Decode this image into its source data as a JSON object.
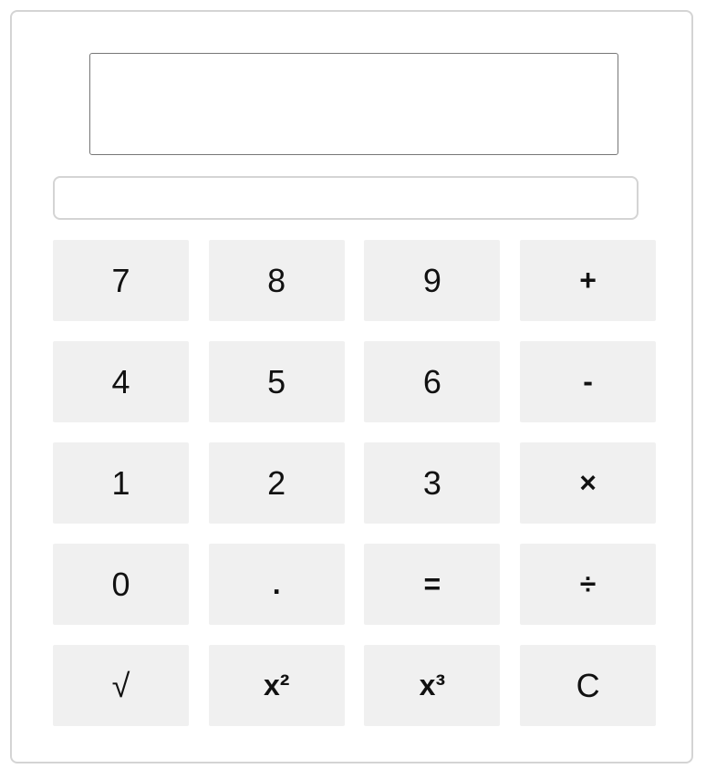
{
  "display": {
    "value": ""
  },
  "input": {
    "value": "",
    "placeholder": ""
  },
  "keys": [
    {
      "label": "7",
      "name": "key-7-button",
      "op": false
    },
    {
      "label": "8",
      "name": "key-8-button",
      "op": false
    },
    {
      "label": "9",
      "name": "key-9-button",
      "op": false
    },
    {
      "label": "+",
      "name": "add-button",
      "op": true
    },
    {
      "label": "4",
      "name": "key-4-button",
      "op": false
    },
    {
      "label": "5",
      "name": "key-5-button",
      "op": false
    },
    {
      "label": "6",
      "name": "key-6-button",
      "op": false
    },
    {
      "label": "-",
      "name": "subtract-button",
      "op": true
    },
    {
      "label": "1",
      "name": "key-1-button",
      "op": false
    },
    {
      "label": "2",
      "name": "key-2-button",
      "op": false
    },
    {
      "label": "3",
      "name": "key-3-button",
      "op": false
    },
    {
      "label": "×",
      "name": "multiply-button",
      "op": true
    },
    {
      "label": "0",
      "name": "key-0-button",
      "op": false
    },
    {
      "label": ".",
      "name": "decimal-point-button",
      "op": true
    },
    {
      "label": "=",
      "name": "equals-button",
      "op": true
    },
    {
      "label": "÷",
      "name": "divide-button",
      "op": true
    },
    {
      "label": "√",
      "name": "square-root-button",
      "op": false
    },
    {
      "label": "x²",
      "name": "square-button",
      "op": true
    },
    {
      "label": "x³",
      "name": "cube-button",
      "op": true
    },
    {
      "label": "C",
      "name": "clear-button",
      "op": false
    }
  ]
}
